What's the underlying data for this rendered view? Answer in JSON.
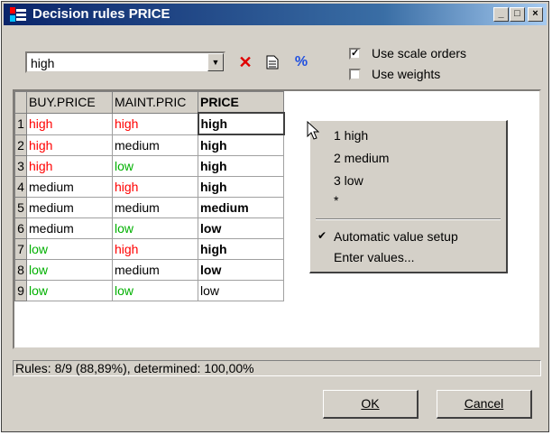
{
  "window": {
    "title": "Decision rules PRICE"
  },
  "titlebar": {
    "minimize_icon": "minimize-icon",
    "maximize_icon": "maximize-icon",
    "close_icon": "close-icon"
  },
  "toolbar": {
    "combo_value": "high",
    "delete_icon": "delete-x-icon",
    "document_icon": "document-icon",
    "percent_icon": "percent-icon"
  },
  "options": {
    "use_scale_orders": {
      "label": "Use scale orders",
      "checked": true
    },
    "use_weights": {
      "label": "Use weights",
      "checked": false
    }
  },
  "grid": {
    "columns": [
      "BUY.PRICE",
      "MAINT.PRIC",
      "PRICE"
    ],
    "rows": [
      {
        "n": "1",
        "buy": "high",
        "maint": "high",
        "price": "high"
      },
      {
        "n": "2",
        "buy": "high",
        "maint": "medium",
        "price": "high"
      },
      {
        "n": "3",
        "buy": "high",
        "maint": "low",
        "price": "high"
      },
      {
        "n": "4",
        "buy": "medium",
        "maint": "high",
        "price": "high"
      },
      {
        "n": "5",
        "buy": "medium",
        "maint": "medium",
        "price": "medium"
      },
      {
        "n": "6",
        "buy": "medium",
        "maint": "low",
        "price": "low"
      },
      {
        "n": "7",
        "buy": "low",
        "maint": "high",
        "price": "high"
      },
      {
        "n": "8",
        "buy": "low",
        "maint": "medium",
        "price": "low"
      },
      {
        "n": "9",
        "buy": "low",
        "maint": "low",
        "price": "low"
      }
    ]
  },
  "context_menu": {
    "items": [
      "1 high",
      "2 medium",
      "3 low",
      "*"
    ],
    "auto_label": "Automatic value setup",
    "enter_label": "Enter values..."
  },
  "status": {
    "text": "Rules: 8/9 (88,89%), determined: 100,00%"
  },
  "buttons": {
    "ok": "OK",
    "cancel": "Cancel"
  },
  "colors": {
    "high": "#ff0000",
    "medium": "#000000",
    "low": "#00b000"
  }
}
